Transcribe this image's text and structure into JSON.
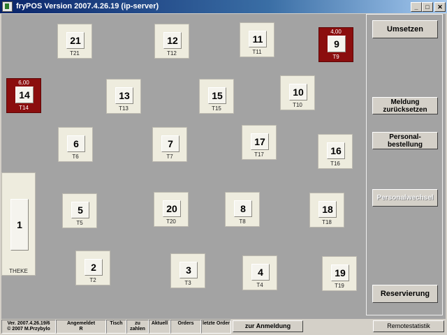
{
  "window": {
    "title": "fryPOS Version 2007.4.26.19 (ip-server)",
    "minimize_glyph": "_",
    "maximize_glyph": "□",
    "close_glyph": "✕"
  },
  "tables": [
    {
      "key": "t21",
      "num": "21",
      "label": "T21",
      "occupied": false
    },
    {
      "key": "t12",
      "num": "12",
      "label": "T12",
      "occupied": false
    },
    {
      "key": "t11",
      "num": "11",
      "label": "T11",
      "occupied": false
    },
    {
      "key": "t9",
      "num": "9",
      "label": "T9",
      "occupied": true,
      "amount": "4,00"
    },
    {
      "key": "t14",
      "num": "14",
      "label": "T14",
      "occupied": true,
      "amount": "6,00"
    },
    {
      "key": "t13",
      "num": "13",
      "label": "T13",
      "occupied": false
    },
    {
      "key": "t15",
      "num": "15",
      "label": "T15",
      "occupied": false
    },
    {
      "key": "t10",
      "num": "10",
      "label": "T10",
      "occupied": false
    },
    {
      "key": "t6",
      "num": "6",
      "label": "T6",
      "occupied": false
    },
    {
      "key": "t7",
      "num": "7",
      "label": "T7",
      "occupied": false
    },
    {
      "key": "t17",
      "num": "17",
      "label": "T17",
      "occupied": false
    },
    {
      "key": "t16",
      "num": "16",
      "label": "T16",
      "occupied": false
    },
    {
      "key": "t5",
      "num": "5",
      "label": "T5",
      "occupied": false
    },
    {
      "key": "t20",
      "num": "20",
      "label": "T20",
      "occupied": false
    },
    {
      "key": "t8",
      "num": "8",
      "label": "T8",
      "occupied": false
    },
    {
      "key": "t18",
      "num": "18",
      "label": "T18",
      "occupied": false
    },
    {
      "key": "t2",
      "num": "2",
      "label": "T2",
      "occupied": false
    },
    {
      "key": "t3",
      "num": "3",
      "label": "T3",
      "occupied": false
    },
    {
      "key": "t4",
      "num": "4",
      "label": "T4",
      "occupied": false
    },
    {
      "key": "t19",
      "num": "19",
      "label": "T19",
      "occupied": false
    }
  ],
  "theke": {
    "num": "1",
    "label": "THEKE"
  },
  "side_buttons": {
    "umsetzen": "Umsetzen",
    "meldung_line1": "Meldung",
    "meldung_line2": "zurücksetzen",
    "personal_line1": "Personal-",
    "personal_line2": "bestellung",
    "personalwechsel": "Personalwechsel",
    "reservierung": "Reservierung"
  },
  "status": {
    "version_line1": "Ver. 2007.4.26.19/6",
    "version_line2": "© 2007 M.Przybylo",
    "angemeldet_label": "Angemeldet",
    "angemeldet_value": "R",
    "tisch": "Tisch",
    "zu_zahlen": "zu zahlen",
    "aktuell": "Aktuell",
    "orders": "Orders",
    "letzte_order": "letzte Order",
    "zur_anmeldung": "zur Anmeldung",
    "remotestatistik": "Remotestatistik"
  }
}
